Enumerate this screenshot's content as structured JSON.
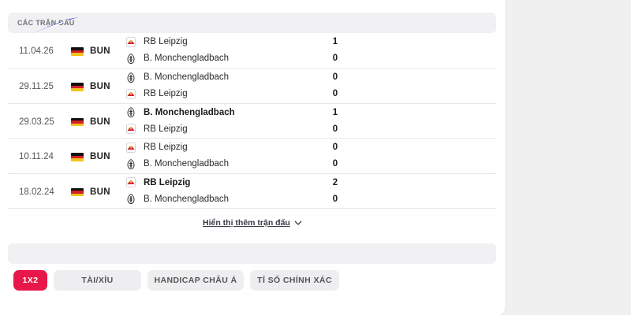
{
  "section": {
    "title": "CÁC TRẬN ĐẤU"
  },
  "matches": [
    {
      "date": "11.04.26",
      "league": "BUN",
      "home": {
        "name": "RB Leipzig",
        "icon": "rb-leipzig-crest-icon",
        "bold": false
      },
      "away": {
        "name": "B. Monchengladbach",
        "icon": "gladbach-crest-icon",
        "bold": false
      },
      "home_score": "1",
      "away_score": "0"
    },
    {
      "date": "29.11.25",
      "league": "BUN",
      "home": {
        "name": "B. Monchengladbach",
        "icon": "gladbach-crest-icon",
        "bold": false
      },
      "away": {
        "name": "RB Leipzig",
        "icon": "rb-leipzig-crest-icon",
        "bold": false
      },
      "home_score": "0",
      "away_score": "0"
    },
    {
      "date": "29.03.25",
      "league": "BUN",
      "home": {
        "name": "B. Monchengladbach",
        "icon": "gladbach-crest-icon",
        "bold": true
      },
      "away": {
        "name": "RB Leipzig",
        "icon": "rb-leipzig-crest-icon",
        "bold": false
      },
      "home_score": "1",
      "away_score": "0"
    },
    {
      "date": "10.11.24",
      "league": "BUN",
      "home": {
        "name": "RB Leipzig",
        "icon": "rb-leipzig-crest-icon",
        "bold": false
      },
      "away": {
        "name": "B. Monchengladbach",
        "icon": "gladbach-crest-icon",
        "bold": false
      },
      "home_score": "0",
      "away_score": "0"
    },
    {
      "date": "18.02.24",
      "league": "BUN",
      "home": {
        "name": "RB Leipzig",
        "icon": "rb-leipzig-crest-icon",
        "bold": true
      },
      "away": {
        "name": "B. Monchengladbach",
        "icon": "gladbach-crest-icon",
        "bold": false
      },
      "home_score": "2",
      "away_score": "0"
    }
  ],
  "more_link": "Hiển thị thêm trận đấu",
  "tabs": [
    {
      "label": "1X2",
      "active": true
    },
    {
      "label": "TÀI/XỈU",
      "active": false
    },
    {
      "label": "HANDICAP CHÂU Á",
      "active": false
    },
    {
      "label": "TỈ SỐ CHÍNH XÁC",
      "active": false
    }
  ],
  "colors": {
    "accent": "#e8174b",
    "flag": [
      "#111111",
      "#d21f26",
      "#f3c31c"
    ]
  }
}
